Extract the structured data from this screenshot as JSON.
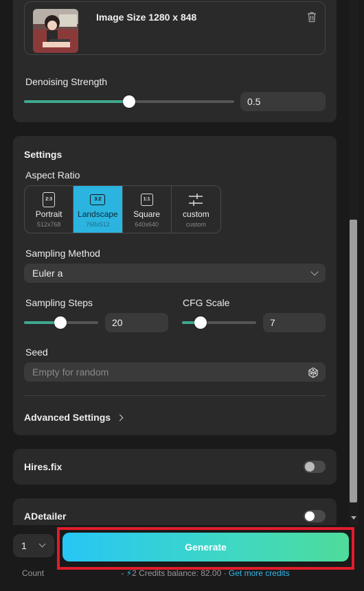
{
  "image_card": {
    "size_label": "Image Size 1280 x 848",
    "denoising_label": "Denoising Strength",
    "denoising_value": "0.5",
    "denoising_fraction": 0.5
  },
  "settings": {
    "title": "Settings",
    "aspect_label": "Aspect Ratio",
    "ratios": [
      {
        "icon": "2:3",
        "name": "Portrait",
        "dim": "512x768"
      },
      {
        "icon": "3:2",
        "name": "Landscape",
        "dim": "768x512"
      },
      {
        "icon": "1:1",
        "name": "Square",
        "dim": "640x640"
      },
      {
        "icon": "",
        "name": "custom",
        "dim": "custom"
      }
    ],
    "selected_ratio": "Landscape",
    "sampling_method_label": "Sampling Method",
    "sampling_method_value": "Euler a",
    "steps_label": "Sampling Steps",
    "steps_value": "20",
    "cfg_label": "CFG Scale",
    "cfg_value": "7",
    "seed_label": "Seed",
    "seed_placeholder": "Empty for random",
    "advanced_label": "Advanced Settings"
  },
  "hires": {
    "label": "Hires.fix",
    "enabled": false
  },
  "adetailer": {
    "label": "ADetailer",
    "enabled": false
  },
  "bottom": {
    "count_value": "1",
    "count_label": "Count",
    "generate_label": "Generate",
    "credits_prefix": "- ",
    "credits_amount": "2",
    "credits_text": " Credits balance: 82.00 · ",
    "get_more": "Get more credits"
  },
  "colors": {
    "accent": "#2cb4e0",
    "slider": "#3fa98f",
    "highlight": "#e11d2b"
  }
}
